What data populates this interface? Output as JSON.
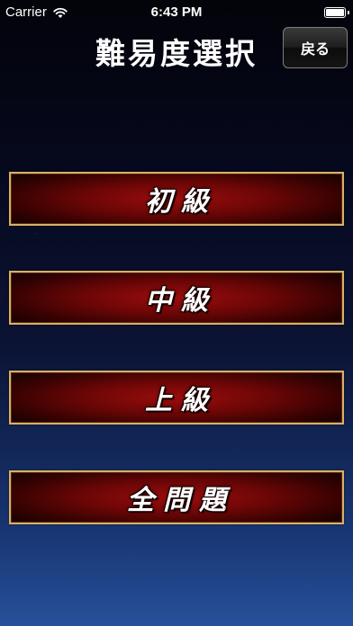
{
  "status_bar": {
    "carrier": "Carrier",
    "time": "6:43 PM",
    "icons": [
      "wifi-icon",
      "battery-icon"
    ]
  },
  "header": {
    "title": "難易度選択",
    "back_label": "戻る"
  },
  "levels": [
    {
      "label": "初級"
    },
    {
      "label": "中級"
    },
    {
      "label": "上級"
    },
    {
      "label": "全問題"
    }
  ],
  "colors": {
    "button_red": "#9c0d0d",
    "button_border": "#d8b06a",
    "background_top": "#03030a",
    "background_bottom": "#28509a"
  }
}
